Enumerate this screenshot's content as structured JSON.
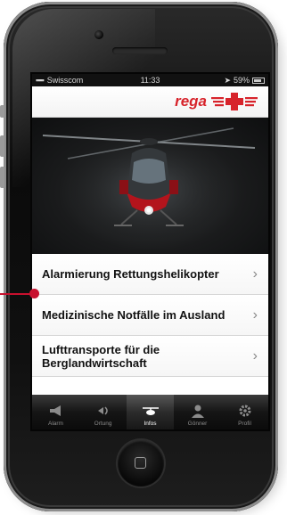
{
  "colors": {
    "brand_red": "#d7232b",
    "callout_red": "#c8102e",
    "tabbar_dark": "#151515",
    "screen_bg": "#ffffff"
  },
  "statusbar": {
    "signal": "▪▪▪▪",
    "carrier": "Swisscom",
    "time": "11:33",
    "battery": "59%"
  },
  "header": {
    "logo_text": "rega",
    "logo_icon": "swiss-cross-wings-icon"
  },
  "hero": {
    "image": "rescue-helicopter-night-photo"
  },
  "menu": [
    {
      "label": "Alarmierung Rettungshelikopter",
      "icon": "chevron-right-icon"
    },
    {
      "label": "Medizinische Notfälle im Ausland",
      "icon": "chevron-right-icon"
    },
    {
      "label": "Lufttransporte für die Berglandwirtschaft",
      "icon": "chevron-right-icon"
    }
  ],
  "tabbar": {
    "tabs": [
      {
        "label": "Alarm",
        "icon": "megaphone-icon",
        "active": false
      },
      {
        "label": "Ortung",
        "icon": "locate-icon",
        "active": false
      },
      {
        "label": "Infos",
        "icon": "helicopter-icon",
        "active": true
      },
      {
        "label": "Gönner",
        "icon": "person-icon",
        "active": false
      },
      {
        "label": "Profil",
        "icon": "gear-icon",
        "active": false
      }
    ]
  }
}
